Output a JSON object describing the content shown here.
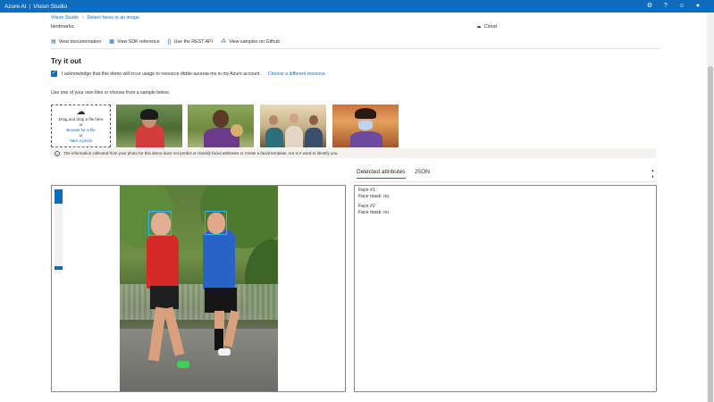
{
  "topbar": {
    "brand": "Azure AI",
    "product": "Vision Studio"
  },
  "breadcrumb": {
    "root": "Vision Studio",
    "current": "Detect faces in an image"
  },
  "header": {
    "landmarks_text": "landmarks.",
    "cloud_label": "Cloud"
  },
  "links": [
    {
      "label": "View documentation",
      "icon": "document-icon"
    },
    {
      "label": "View SDK reference",
      "icon": "code-icon"
    },
    {
      "label": "Use the REST API",
      "icon": "braces-icon"
    },
    {
      "label": "View samples on Github",
      "icon": "sample-icon"
    }
  ],
  "tryit": {
    "title": "Try it out",
    "ack_text": "I acknowledge that this demo will incur usage to resource dtdde-azureai-ms in my Azure account.",
    "ack_link": "Choose a different resource.",
    "use_own": "Use one of your own files or choose from a sample below."
  },
  "dropzone": {
    "line1": "Drag and drop a file here",
    "or1": "or",
    "browse": "Browse for a file",
    "or2": "or",
    "photo": "Take a photo"
  },
  "info_text": "The information collected from your photo for this demo does not predict or classify facial attributes or create a facial template, nor is it used to identify you.",
  "tabs": {
    "detected": "Detected attributes",
    "json": "JSON"
  },
  "faces": [
    {
      "title": "Face #1",
      "attr": "Face mask: no"
    },
    {
      "title": "Face #2",
      "attr": "Face mask: no"
    }
  ],
  "colors": {
    "accent": "#0f6cbd"
  }
}
